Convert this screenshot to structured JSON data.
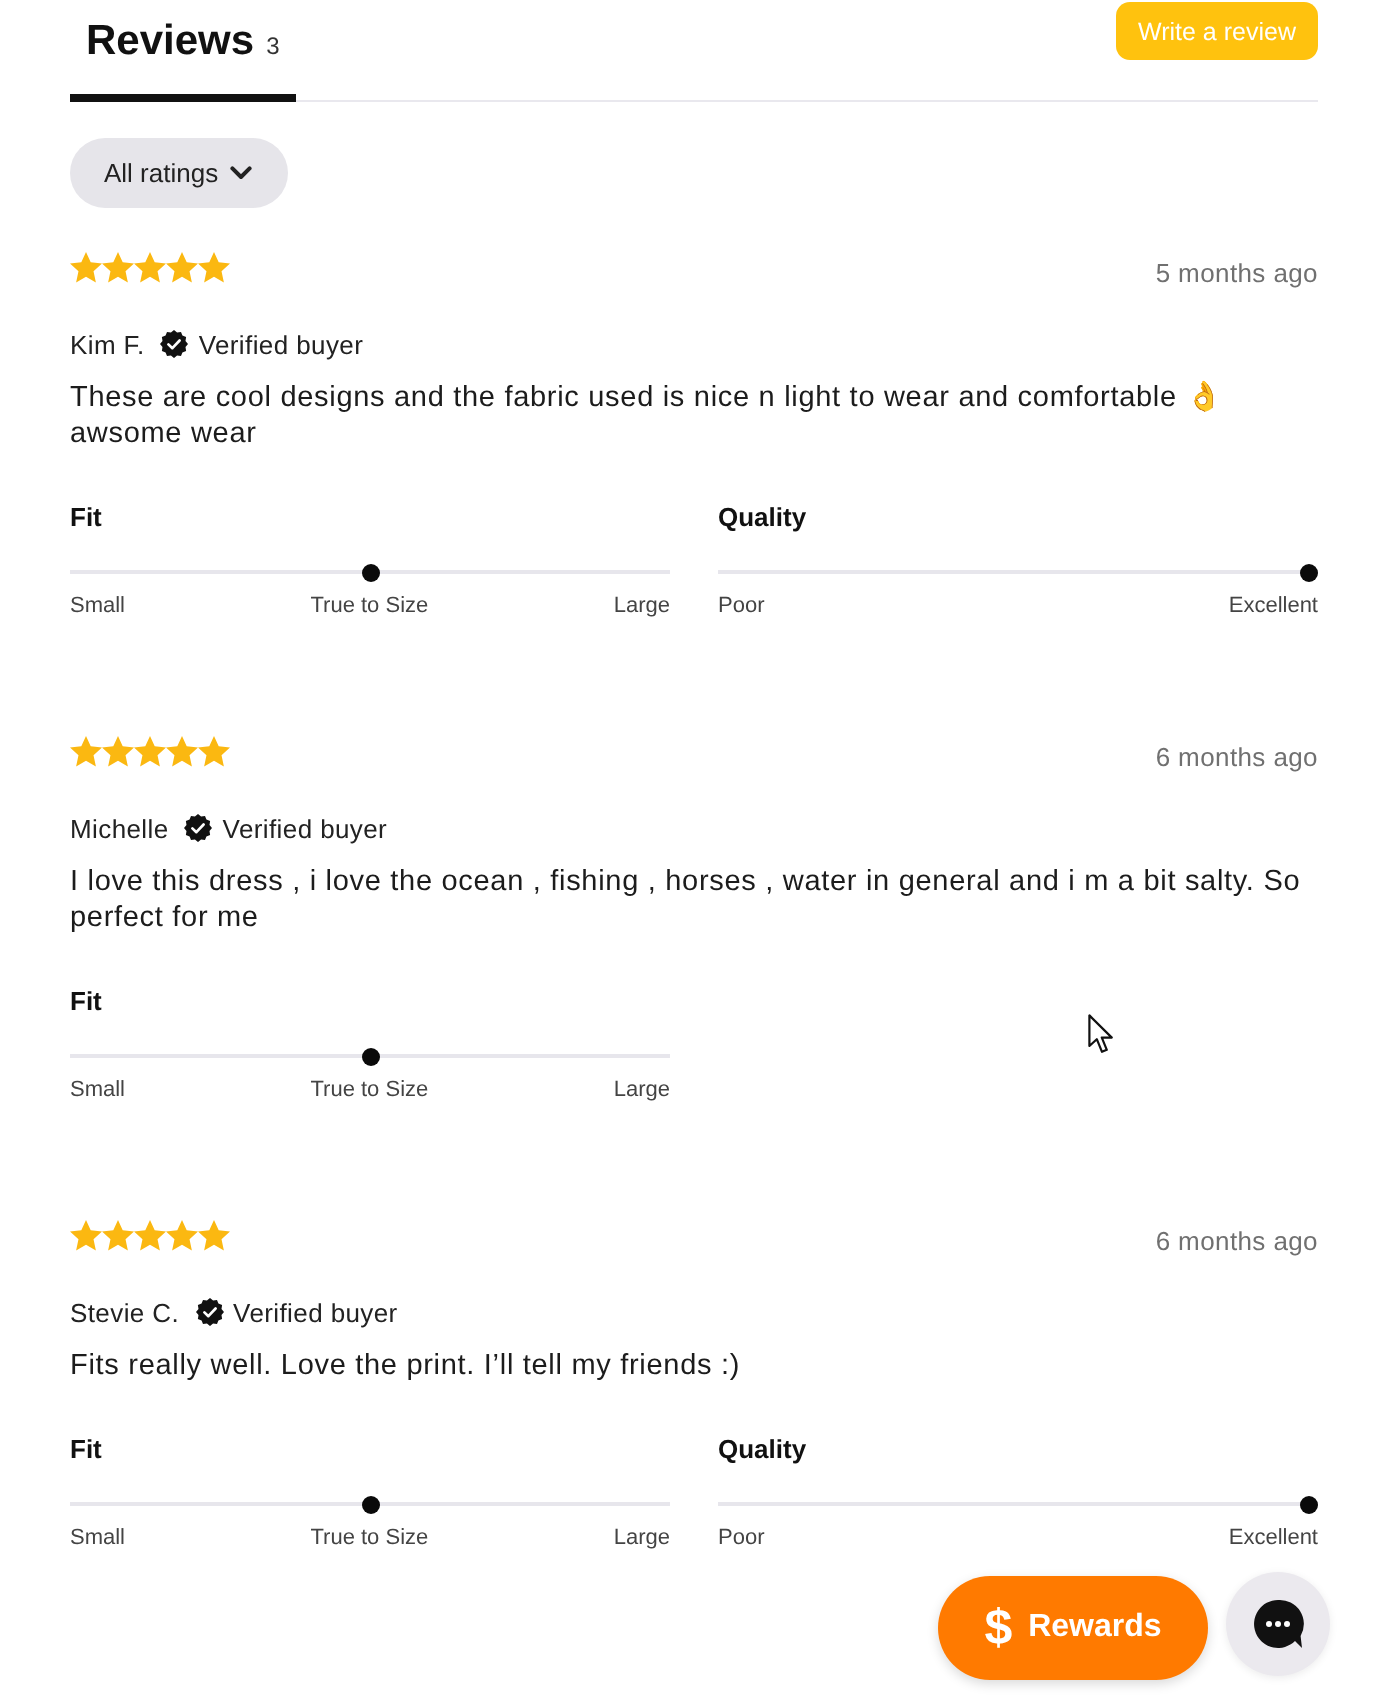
{
  "header": {
    "tabs": [
      {
        "label": "Reviews",
        "count": "3",
        "selected": true
      }
    ],
    "write_button": "Write a review"
  },
  "filter": {
    "label": "All ratings"
  },
  "reviews": [
    {
      "stars": 5,
      "date": "5 months ago",
      "author": "Kim F.",
      "verified": true,
      "verified_label": "Verified buyer",
      "text": "These are cool designs and the fabric used is nice n light to wear and comfortable 👌 awsome wear",
      "scales": [
        {
          "name": "Fit",
          "level": 0.5,
          "labels": [
            "Small",
            "True to Size",
            "Large"
          ]
        },
        {
          "name": "Quality",
          "level": 1,
          "labels": [
            "Poor",
            "Excellent"
          ]
        }
      ]
    },
    {
      "stars": 5,
      "date": "6 months ago",
      "author": "Michelle",
      "verified": true,
      "verified_label": "Verified buyer",
      "text": "I love this dress , i love the ocean , fishing , horses , water in general and i m a bit salty. So perfect for me",
      "scales": [
        {
          "name": "Fit",
          "level": 0.5,
          "labels": [
            "Small",
            "True to Size",
            "Large"
          ]
        }
      ]
    },
    {
      "stars": 5,
      "date": "6 months ago",
      "author": "Stevie C.",
      "verified": true,
      "verified_label": "Verified buyer",
      "text": "Fits really well. Love the print. I’ll tell my friends :)",
      "scales": [
        {
          "name": "Fit",
          "level": 0.5,
          "labels": [
            "Small",
            "True to Size",
            "Large"
          ]
        },
        {
          "name": "Quality",
          "level": 1,
          "labels": [
            "Poor",
            "Excellent"
          ]
        }
      ]
    }
  ],
  "rewards": {
    "icon": "$",
    "label": "Rewards"
  }
}
